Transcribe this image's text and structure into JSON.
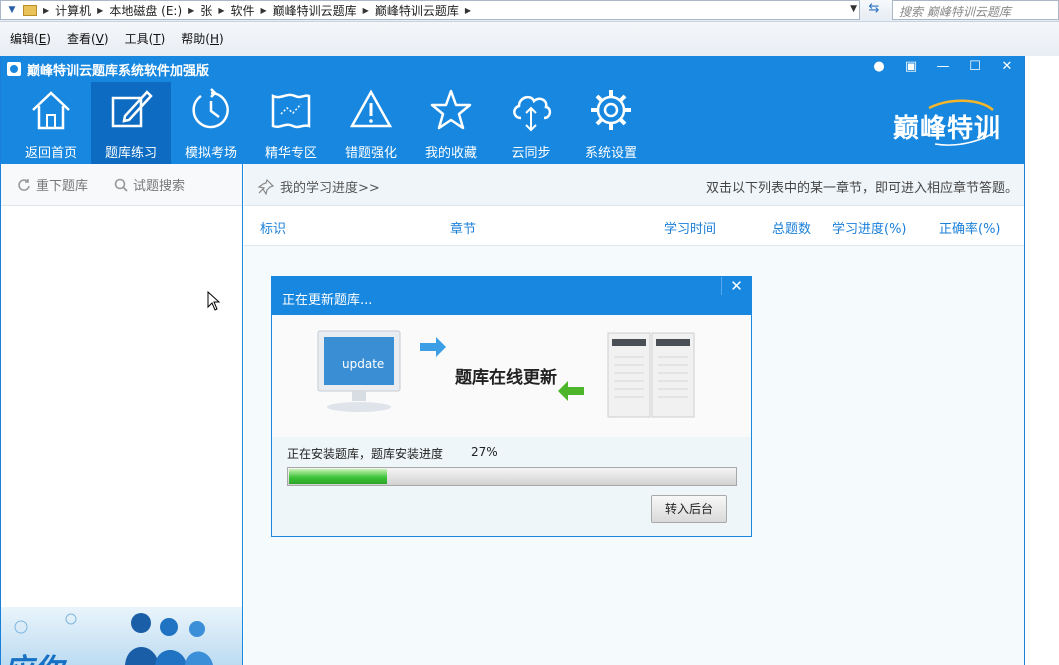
{
  "explorer": {
    "breadcrumbs": [
      "计算机",
      "本地磁盘 (E:)",
      "张",
      "软件",
      "巅峰特训云题库",
      "巅峰特训云题库"
    ],
    "search_placeholder": "搜索 巅峰特训云题库"
  },
  "menubar": {
    "items": [
      {
        "label": "编辑(",
        "key": "E",
        "tail": ")"
      },
      {
        "label": "查看(",
        "key": "V",
        "tail": ")"
      },
      {
        "label": "工具(",
        "key": "T",
        "tail": ")"
      },
      {
        "label": "帮助(",
        "key": "H",
        "tail": ")"
      }
    ]
  },
  "app": {
    "title": "巅峰特训云题库系统软件加强版",
    "brand": "巅峰特训",
    "colors": {
      "primary": "#1787e0",
      "active": "#0d6cc2",
      "link": "#1a7fd9",
      "progress": "#3fc43b"
    },
    "toolbar": [
      {
        "label": "返回首页",
        "icon": "home-icon"
      },
      {
        "label": "题库练习",
        "icon": "edit-icon"
      },
      {
        "label": "模拟考场",
        "icon": "clock-icon"
      },
      {
        "label": "精华专区",
        "icon": "map-icon"
      },
      {
        "label": "错题强化",
        "icon": "warning-icon"
      },
      {
        "label": "我的收藏",
        "icon": "star-icon"
      },
      {
        "label": "云同步",
        "icon": "cloud-sync-icon"
      },
      {
        "label": "系统设置",
        "icon": "gear-icon"
      }
    ],
    "active_tab": "题库练习"
  },
  "left_panel": {
    "reload_label": "重下题库",
    "search_label": "试题搜索",
    "banner_text": "应你"
  },
  "right_panel": {
    "progress_link": "我的学习进度>>",
    "hint": "双击以下列表中的某一章节，即可进入相应章节答题。",
    "columns": [
      "标识",
      "章节",
      "学习时间",
      "总题数",
      "学习进度(%)",
      "正确率(%)"
    ]
  },
  "dialog": {
    "title": "正在更新题库...",
    "close": "✕",
    "monitor_text": "update",
    "headline": "题库在线更新",
    "status": "正在安装题库，题库安装进度",
    "percent_text": "27%",
    "progress": 0.22,
    "button": "转入后台"
  }
}
